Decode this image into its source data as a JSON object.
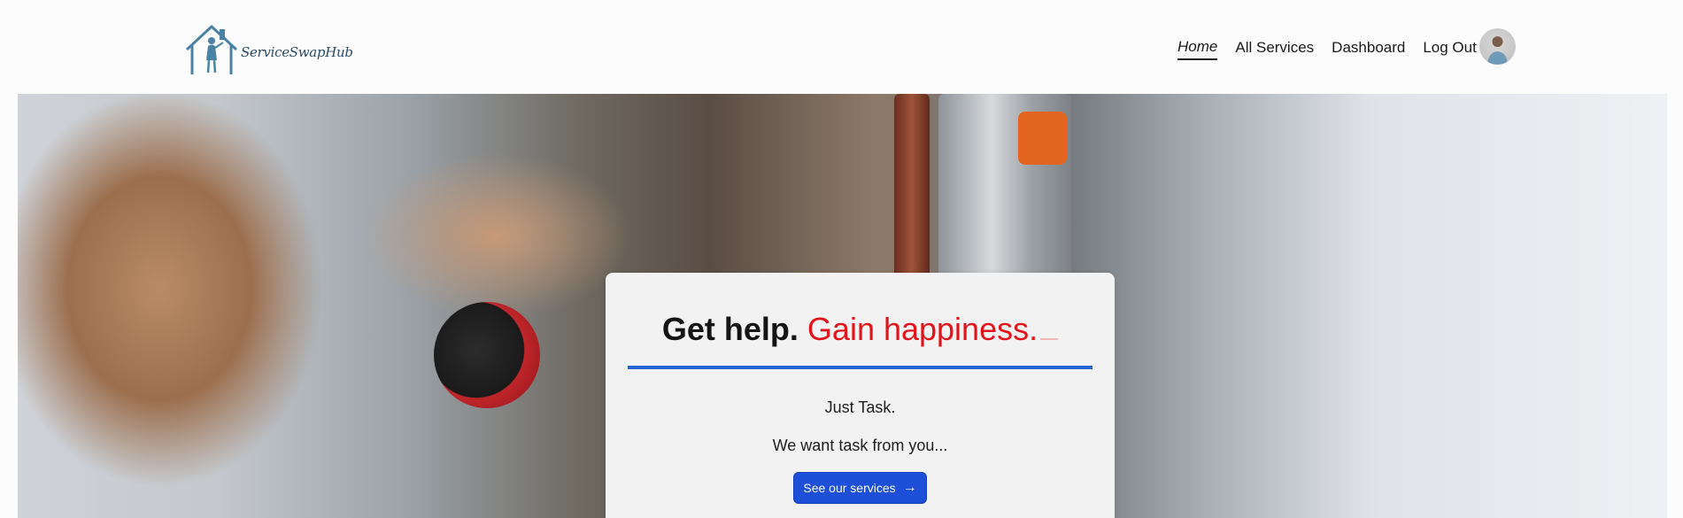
{
  "brand": {
    "name": "ServiceSwapHub",
    "logo_color": "#4a82a6"
  },
  "nav": {
    "items": [
      {
        "label": "Home",
        "active": true
      },
      {
        "label": "All Services",
        "active": false
      },
      {
        "label": "Dashboard",
        "active": false
      },
      {
        "label": "Log Out",
        "active": false
      }
    ],
    "avatar_icon": "user-avatar"
  },
  "hero": {
    "headline_bold": "Get help.",
    "headline_accent": "Gain happiness.",
    "tagline": "Just Task.",
    "subtext": "We want task from you...",
    "cta_label": "See our services",
    "cta_icon": "arrow-right-icon",
    "accent_color": "#e3131b",
    "rule_color": "#2563d9",
    "button_color": "#1d4fd8"
  }
}
